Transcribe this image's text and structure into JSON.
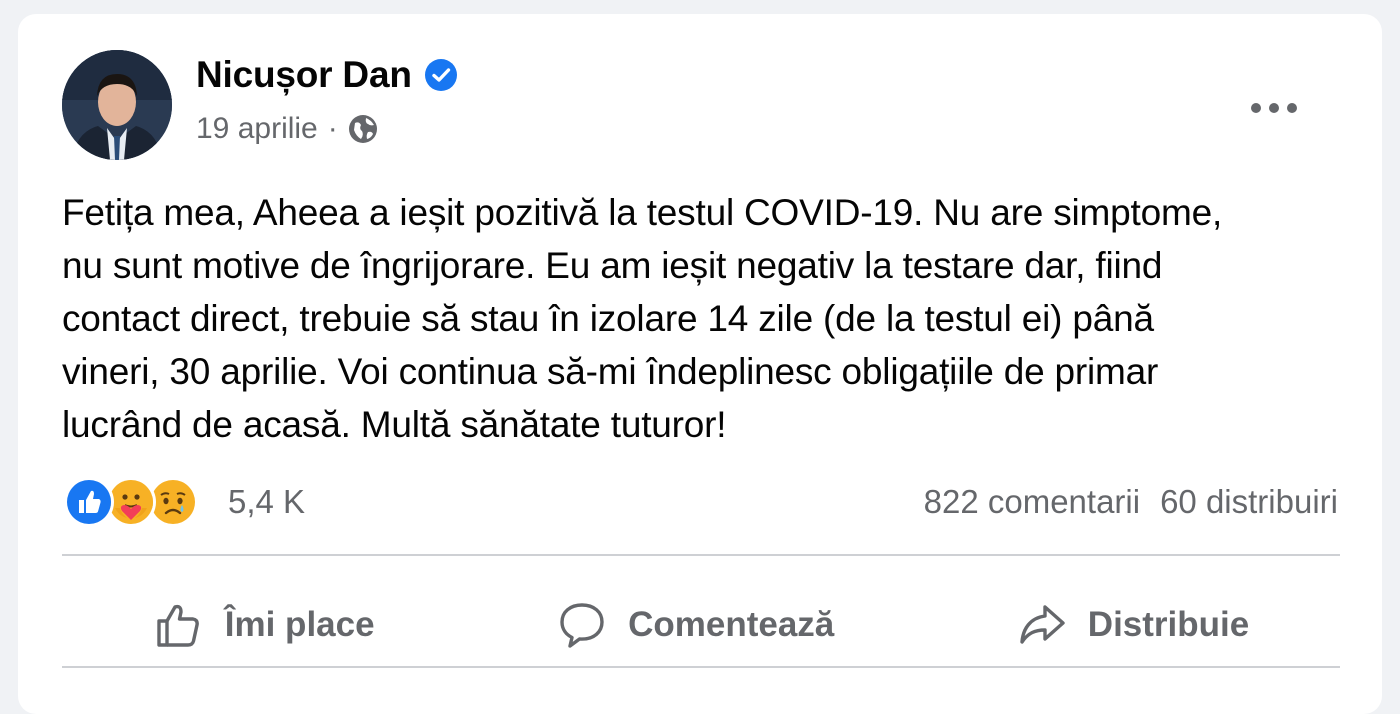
{
  "post": {
    "author": "Nicușor Dan",
    "date": "19 aprilie",
    "separator": "·",
    "privacy_icon": "globe-icon",
    "verified_icon": "verified-badge-icon",
    "more_icon": "more-options-icon",
    "text_lines": [
      "Fetița mea, Aheea a ieșit pozitivă la testul COVID-19. Nu are simptome,",
      "nu sunt motive de îngrijorare. Eu am ieșit negativ la testare dar, fiind",
      "contact direct, trebuie să stau în izolare 14 zile (de la testul ei) până",
      "vineri, 30 aprilie. Voi continua să-mi îndeplinesc obligațiile de primar",
      "lucrând de acasă. Multă sănătate tuturor!"
    ]
  },
  "stats": {
    "reactions": [
      "like-reaction-icon",
      "care-reaction-icon",
      "sad-reaction-icon"
    ],
    "reaction_count": "5,4 K",
    "comments": "822 comentarii",
    "shares": "60 distribuiri"
  },
  "actions": {
    "like": "Îmi place",
    "comment": "Comentează",
    "share": "Distribuie"
  },
  "colors": {
    "brand_blue": "#1877f2",
    "secondary_text": "#65676b",
    "divider": "#ced0d4"
  }
}
